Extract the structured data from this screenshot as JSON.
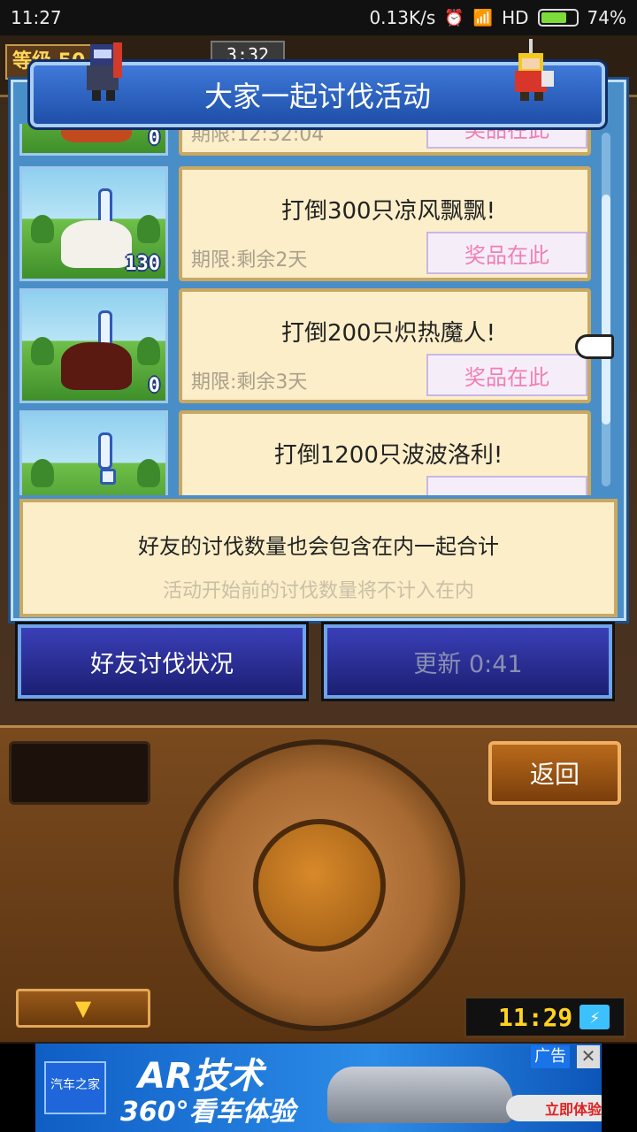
{
  "status_bar": {
    "time": "11:27",
    "network_speed": "0.13K/s",
    "network_type": "HD",
    "battery_percent": "74%",
    "battery_level": 0.74
  },
  "hud": {
    "level_label": "等级 50",
    "timer": "3:32"
  },
  "modal": {
    "title": "大家一起讨伐活动",
    "events": [
      {
        "task": "",
        "deadline": "期限:12:32:04",
        "prize_label": "奖品在此",
        "count": "0",
        "monster_color": "#c24a1f"
      },
      {
        "task": "打倒300只凉风飘飘!",
        "deadline": "期限:剩余2天",
        "prize_label": "奖品在此",
        "count": "130",
        "monster_color": "#f4f0ea"
      },
      {
        "task": "打倒200只炽热魔人!",
        "deadline": "期限:剩余3天",
        "prize_label": "奖品在此",
        "count": "0",
        "monster_color": "#5a1a12"
      },
      {
        "task": "打倒1200只波波洛利!",
        "deadline": "",
        "prize_label": "",
        "count": "",
        "monster_color": "#3c8a2c"
      }
    ],
    "notice": {
      "line1": "好友的讨伐数量也会包含在内一起合计",
      "line2": "活动开始前的讨伐数量将不计入在内"
    },
    "buttons": {
      "friends_status": "好友讨伐状况",
      "refresh": "更新 0:41"
    }
  },
  "controller": {
    "return_label": "返回",
    "down_arrow": "▼",
    "clock": "11:29",
    "clock_icon": "⚡"
  },
  "ad": {
    "headline": "AR技术",
    "subline": "360°看车体验",
    "logo": "汽车之家",
    "cta": "立即体验",
    "tag": "广告",
    "close": "✕"
  },
  "colors": {
    "modal_blue": "#4a8ec8",
    "card_bg": "#fbeec8",
    "prize_text": "#f07fb6"
  }
}
